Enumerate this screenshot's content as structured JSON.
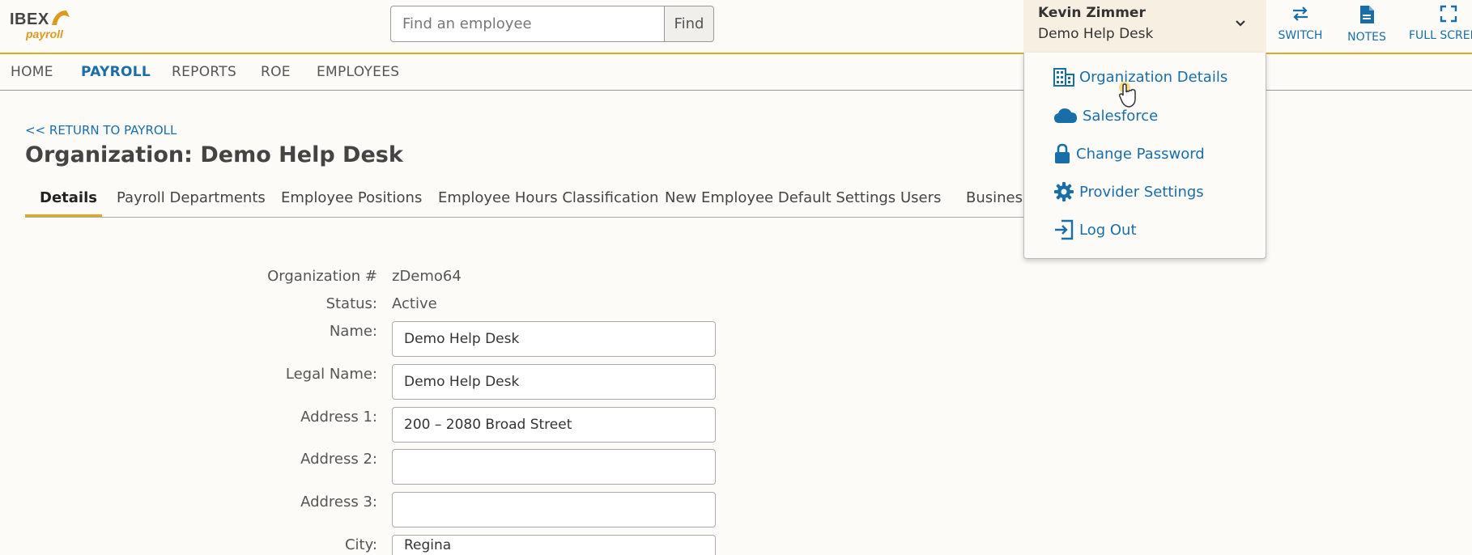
{
  "header": {
    "logo": {
      "brand": "IBEX",
      "sub": "payroll"
    },
    "search": {
      "placeholder": "Find an employee",
      "value": "",
      "button_label": "Find"
    },
    "user": {
      "name": "Kevin Zimmer",
      "org": "Demo Help Desk"
    },
    "buttons": [
      {
        "label": "SWITCH",
        "icon": "switch-arrows-icon"
      },
      {
        "label": "NOTES",
        "icon": "document-icon"
      },
      {
        "label": "FULL SCREEN",
        "icon": "fullscreen-icon"
      }
    ]
  },
  "nav": {
    "items": [
      "HOME",
      "PAYROLL",
      "REPORTS",
      "ROE",
      "EMPLOYEES"
    ],
    "active": "PAYROLL"
  },
  "main": {
    "return_link": "<< RETURN TO PAYROLL",
    "title": "Organization: Demo Help Desk",
    "tabs": [
      "Details",
      "Payroll Departments",
      "Employee Positions",
      "Employee Hours Classification",
      "New Employee Default Settings",
      "Users",
      "Business"
    ],
    "active_tab": "Details",
    "form": {
      "org_number_label": "Organization #",
      "org_number": "zDemo64",
      "status_label": "Status:",
      "status": "Active",
      "name_label": "Name:",
      "name": "Demo Help Desk",
      "legal_name_label": "Legal Name:",
      "legal_name": "Demo Help Desk",
      "address1_label": "Address 1:",
      "address1": "200 – 2080 Broad Street",
      "address2_label": "Address 2:",
      "address2": "",
      "address3_label": "Address 3:",
      "address3": "",
      "city_label": "City:",
      "city": "Regina"
    }
  },
  "user_menu": {
    "items": [
      {
        "label": "Organization Details",
        "icon": "building-icon"
      },
      {
        "label": "Salesforce",
        "icon": "cloud-icon"
      },
      {
        "label": "Change Password",
        "icon": "lock-icon"
      },
      {
        "label": "Provider Settings",
        "icon": "gear-icon"
      },
      {
        "label": "Log Out",
        "icon": "logout-icon"
      }
    ]
  },
  "colors": {
    "accent": "#e8a321",
    "link": "#1a6ea8",
    "background": "#fdfbf8",
    "user_box": "#f7efe1"
  }
}
